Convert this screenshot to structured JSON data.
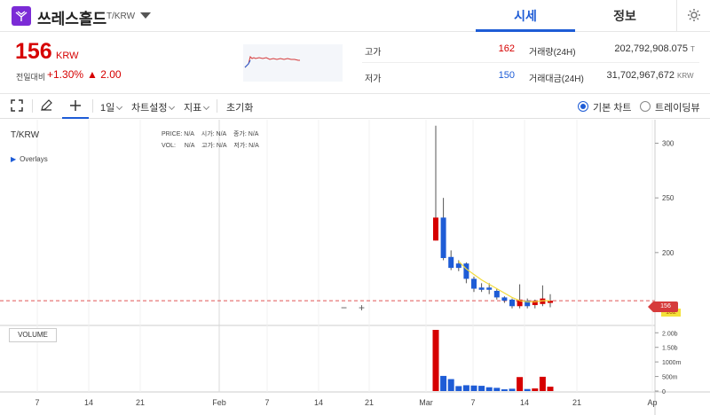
{
  "header": {
    "coin_name": "쓰레스홀드",
    "pair": "T/KRW",
    "tabs": [
      {
        "label": "시세",
        "active": true
      },
      {
        "label": "정보",
        "active": false
      }
    ],
    "accent_color": "#1e5cd6",
    "logo_color": "#7b2bd6"
  },
  "summary": {
    "price": "156",
    "price_unit": "KRW",
    "change_label": "전일대비",
    "change_pct": "+1.30%",
    "change_abs": "▲ 2.00",
    "up_color": "#d60000",
    "down_color": "#1e5cd6",
    "high_label": "고가",
    "high_value": "162",
    "low_label": "저가",
    "low_value": "150",
    "volume_label": "거래량(24H)",
    "volume_value": "202,792,908.075",
    "volume_unit": "T",
    "amount_label": "거래대금(24H)",
    "amount_value": "31,702,967,672",
    "amount_unit": "KRW"
  },
  "toolbar": {
    "interval": "1일",
    "chart_settings": "차트설정",
    "indicators": "지표",
    "reset": "초기화",
    "chart_modes": [
      {
        "label": "기본 차트",
        "selected": true
      },
      {
        "label": "트레이딩뷰",
        "selected": false
      }
    ]
  },
  "chart": {
    "pair": "T/KRW",
    "overlays_label": "Overlays",
    "ohlc_row1": [
      {
        "k": "PRICE:",
        "v": "N/A"
      },
      {
        "k": "시가:",
        "v": "N/A"
      },
      {
        "k": "종가:",
        "v": "N/A"
      }
    ],
    "ohlc_row2": [
      {
        "k": "VOL:",
        "v": "N/A"
      },
      {
        "k": "고가:",
        "v": "N/A"
      },
      {
        "k": "저가:",
        "v": "N/A"
      }
    ],
    "volume_label": "VOLUME",
    "current_price_badge": "156",
    "ma_badge": "162",
    "zoom_minus": "−",
    "zoom_plus": "+"
  },
  "chart_data": {
    "type": "candlestick",
    "x_ticks": [
      "7",
      "14",
      "21",
      "Feb",
      "7",
      "14",
      "21",
      "Mar",
      "7",
      "14",
      "21",
      "Ap"
    ],
    "y_ticks": [
      "300",
      "250",
      "200",
      "150"
    ],
    "y_ticks_values": [
      300,
      250,
      200,
      150
    ],
    "ylim": [
      135,
      315
    ],
    "volume_ticks": [
      "2.00b",
      "1.50b",
      "1000m",
      "500m",
      "0"
    ],
    "volume_ticks_values": [
      2000,
      1500,
      1000,
      500,
      0
    ],
    "volume_unit": "m",
    "current_price": 156,
    "grid": true,
    "candles": [
      {
        "o": 211,
        "c": 232,
        "h": 316,
        "l": 211
      },
      {
        "o": 232,
        "c": 195,
        "h": 250,
        "l": 193
      },
      {
        "o": 196,
        "c": 186,
        "h": 202,
        "l": 184
      },
      {
        "o": 190,
        "c": 186,
        "h": 193,
        "l": 183
      },
      {
        "o": 190,
        "c": 176,
        "h": 191,
        "l": 172
      },
      {
        "o": 176,
        "c": 167,
        "h": 178,
        "l": 164
      },
      {
        "o": 168,
        "c": 166,
        "h": 172,
        "l": 164
      },
      {
        "o": 168,
        "c": 166,
        "h": 172,
        "l": 162
      },
      {
        "o": 165,
        "c": 159,
        "h": 167,
        "l": 157
      },
      {
        "o": 159,
        "c": 156,
        "h": 160,
        "l": 154
      },
      {
        "o": 157,
        "c": 151,
        "h": 158,
        "l": 149
      },
      {
        "o": 151,
        "c": 157,
        "h": 171,
        "l": 149
      },
      {
        "o": 156,
        "c": 151,
        "h": 158,
        "l": 149
      },
      {
        "o": 152,
        "c": 156,
        "h": 157,
        "l": 149
      },
      {
        "o": 153,
        "c": 158,
        "h": 170,
        "l": 151
      },
      {
        "o": 154,
        "c": 156,
        "h": 162,
        "l": 150
      }
    ],
    "volumes": [
      2100,
      520,
      410,
      170,
      200,
      190,
      180,
      130,
      110,
      60,
      80,
      480,
      70,
      90,
      490,
      150
    ],
    "ma": [
      null,
      null,
      null,
      192,
      185,
      180,
      175,
      171,
      167,
      163,
      159,
      156,
      155,
      155,
      156,
      156
    ]
  }
}
